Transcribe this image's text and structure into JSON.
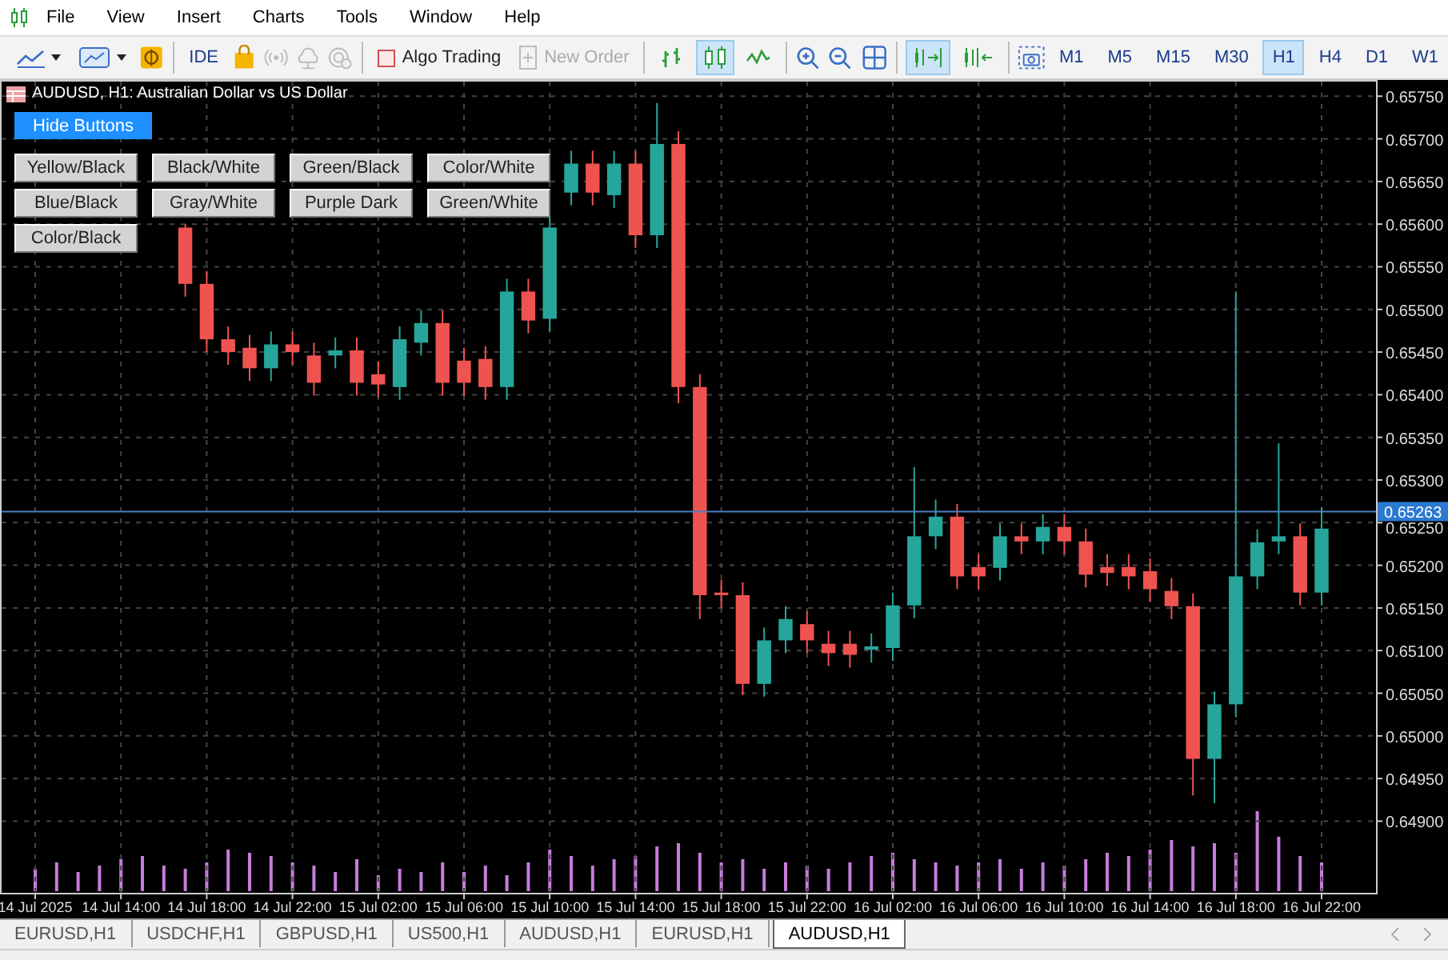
{
  "menu": [
    {
      "label": "File"
    },
    {
      "label": "View"
    },
    {
      "label": "Insert"
    },
    {
      "label": "Charts"
    },
    {
      "label": "Tools"
    },
    {
      "label": "Window"
    },
    {
      "label": "Help"
    }
  ],
  "toolbar": {
    "ide": "IDE",
    "algo_trading": {
      "label": "Algo Trading",
      "checked": false
    },
    "new_order": {
      "label": "New Order",
      "disabled": true
    },
    "chart_types": [
      {
        "selected": false
      },
      {
        "selected": true
      },
      {
        "selected": false
      }
    ],
    "autoscroll": {
      "selected": true
    },
    "chart_shift": {
      "selected": false
    },
    "timeframes": [
      {
        "label": "M1",
        "selected": false
      },
      {
        "label": "M5",
        "selected": false
      },
      {
        "label": "M15",
        "selected": false
      },
      {
        "label": "M30",
        "selected": false
      },
      {
        "label": "H1",
        "selected": true
      },
      {
        "label": "H4",
        "selected": false
      },
      {
        "label": "D1",
        "selected": false
      },
      {
        "label": "W1",
        "selected": false
      }
    ]
  },
  "chart": {
    "title": "AUDUSD, H1:  Australian Dollar vs US Dollar",
    "hide_button": "Hide Buttons",
    "theme_buttons": [
      "Yellow/Black",
      "Black/White",
      "Green/Black",
      "Color/White",
      "Blue/Black",
      "Gray/White",
      "Purple Dark",
      "Green/White",
      "Color/Black"
    ],
    "current_price": "0.65263",
    "chart_data": {
      "type": "candlestick",
      "grid": true,
      "ylim": [
        0.64816,
        0.65769
      ],
      "categories": [
        "14 Jul 2025",
        null,
        null,
        null,
        "14 Jul 14:00",
        null,
        null,
        null,
        "14 Jul 18:00",
        null,
        null,
        null,
        "14 Jul 22:00",
        null,
        null,
        null,
        "15 Jul 02:00",
        null,
        null,
        null,
        "15 Jul 06:00",
        null,
        null,
        null,
        "15 Jul 10:00",
        null,
        null,
        null,
        "15 Jul 14:00",
        null,
        null,
        null,
        "15 Jul 18:00",
        null,
        null,
        null,
        "15 Jul 22:00",
        null,
        null,
        null,
        "16 Jul 02:00",
        null,
        null,
        null,
        "16 Jul 06:00",
        null,
        null,
        null,
        "16 Jul 10:00",
        null,
        null,
        null,
        "16 Jul 14:00",
        null,
        null,
        null,
        "16 Jul 18:00",
        null,
        null,
        null,
        "16 Jul 22:00"
      ],
      "yticks": [
        {
          "value": 0.6575,
          "label": "0.65750"
        },
        {
          "value": 0.657,
          "label": "0.65700"
        },
        {
          "value": 0.6565,
          "label": "0.65650"
        },
        {
          "value": 0.656,
          "label": "0.65600"
        },
        {
          "value": 0.6555,
          "label": "0.65550"
        },
        {
          "value": 0.655,
          "label": "0.65500"
        },
        {
          "value": 0.6545,
          "label": "0.65450"
        },
        {
          "value": 0.654,
          "label": "0.65400"
        },
        {
          "value": 0.6535,
          "label": "0.65350"
        },
        {
          "value": 0.653,
          "label": "0.65300"
        },
        {
          "value": 0.6525,
          "label": "0.65250"
        },
        {
          "value": 0.652,
          "label": "0.65200"
        },
        {
          "value": 0.6515,
          "label": "0.65150"
        },
        {
          "value": 0.651,
          "label": "0.65100"
        },
        {
          "value": 0.6505,
          "label": "0.65050"
        },
        {
          "value": 0.65,
          "label": "0.65000"
        },
        {
          "value": 0.6495,
          "label": "0.64950"
        },
        {
          "value": 0.649,
          "label": "0.64900"
        }
      ],
      "ohlc": [
        null,
        null,
        null,
        null,
        null,
        null,
        null,
        [
          0.65596,
          0.656,
          0.65515,
          0.6553
        ],
        [
          0.6553,
          0.65545,
          0.6545,
          0.65465
        ],
        [
          0.65465,
          0.6548,
          0.65435,
          0.6545
        ],
        [
          0.65455,
          0.6547,
          0.65416,
          0.65431
        ],
        [
          0.65431,
          0.65474,
          0.65416,
          0.65459
        ],
        [
          0.65459,
          0.65474,
          0.65435,
          0.6545
        ],
        [
          0.65446,
          0.65461,
          0.65399,
          0.65414
        ],
        [
          0.65446,
          0.65467,
          0.65431,
          0.65452
        ],
        [
          0.65452,
          0.65467,
          0.65399,
          0.65414
        ],
        [
          0.65424,
          0.65439,
          0.65397,
          0.65412
        ],
        [
          0.65409,
          0.6548,
          0.65394,
          0.65465
        ],
        [
          0.65461,
          0.65499,
          0.65446,
          0.65484
        ],
        [
          0.65484,
          0.65499,
          0.65399,
          0.65414
        ],
        [
          0.6544,
          0.65455,
          0.65399,
          0.65414
        ],
        [
          0.65442,
          0.65457,
          0.65394,
          0.65409
        ],
        [
          0.65409,
          0.65536,
          0.65394,
          0.65521
        ],
        [
          0.65521,
          0.65536,
          0.65472,
          0.65487
        ],
        [
          0.65489,
          0.65611,
          0.65474,
          0.65596
        ],
        [
          0.65637,
          0.65686,
          0.65622,
          0.65671
        ],
        [
          0.65671,
          0.65686,
          0.65622,
          0.65637
        ],
        [
          0.65634,
          0.65686,
          0.65619,
          0.65671
        ],
        [
          0.65671,
          0.65686,
          0.65572,
          0.65587
        ],
        [
          0.65587,
          0.65742,
          0.65572,
          0.65694
        ],
        [
          0.65694,
          0.65709,
          0.6539,
          0.65409
        ],
        [
          0.65409,
          0.65424,
          0.65137,
          0.65165
        ],
        [
          0.65168,
          0.65183,
          0.6515,
          0.65165
        ],
        [
          0.65165,
          0.6518,
          0.65048,
          0.65061
        ],
        [
          0.65061,
          0.65127,
          0.65046,
          0.65112
        ],
        [
          0.65112,
          0.65152,
          0.65097,
          0.65137
        ],
        [
          0.65131,
          0.65146,
          0.65097,
          0.65112
        ],
        [
          0.65108,
          0.65123,
          0.65082,
          0.65097
        ],
        [
          0.65108,
          0.65123,
          0.6508,
          0.65095
        ],
        [
          0.65101,
          0.6512,
          0.65086,
          0.65105
        ],
        [
          0.65103,
          0.65168,
          0.65088,
          0.65153
        ],
        [
          0.65153,
          0.65315,
          0.65138,
          0.65234
        ],
        [
          0.65234,
          0.65277,
          0.65219,
          0.65257
        ],
        [
          0.65257,
          0.65272,
          0.65172,
          0.65187
        ],
        [
          0.65198,
          0.65213,
          0.65172,
          0.65187
        ],
        [
          0.65197,
          0.65249,
          0.65182,
          0.65234
        ],
        [
          0.65234,
          0.65249,
          0.65213,
          0.65228
        ],
        [
          0.65228,
          0.6526,
          0.65213,
          0.65245
        ],
        [
          0.65245,
          0.6526,
          0.65213,
          0.65228
        ],
        [
          0.65228,
          0.65243,
          0.65174,
          0.65189
        ],
        [
          0.65198,
          0.65213,
          0.65176,
          0.65191
        ],
        [
          0.65198,
          0.65213,
          0.65172,
          0.65187
        ],
        [
          0.65193,
          0.65208,
          0.65157,
          0.65172
        ],
        [
          0.6517,
          0.65185,
          0.65137,
          0.65152
        ],
        [
          0.65152,
          0.65167,
          0.6493,
          0.64973
        ],
        [
          0.64973,
          0.65052,
          0.64921,
          0.65037
        ],
        [
          0.65037,
          0.65521,
          0.65022,
          0.65187
        ],
        [
          0.65187,
          0.65242,
          0.65172,
          0.65227
        ],
        [
          0.65228,
          0.65343,
          0.65213,
          0.65234
        ],
        [
          0.65234,
          0.65249,
          0.65153,
          0.65168
        ],
        [
          0.65168,
          0.65268,
          0.65153,
          0.65243
        ]
      ]
    }
  },
  "tabs": [
    {
      "label": "EURUSD,H1",
      "selected": false
    },
    {
      "label": "USDCHF,H1",
      "selected": false
    },
    {
      "label": "GBPUSD,H1",
      "selected": false
    },
    {
      "label": "US500,H1",
      "selected": false
    },
    {
      "label": "AUDUSD,H1",
      "selected": false
    },
    {
      "label": "EURUSD,H1",
      "selected": false
    },
    {
      "label": "AUDUSD,H1",
      "selected": true
    }
  ]
}
